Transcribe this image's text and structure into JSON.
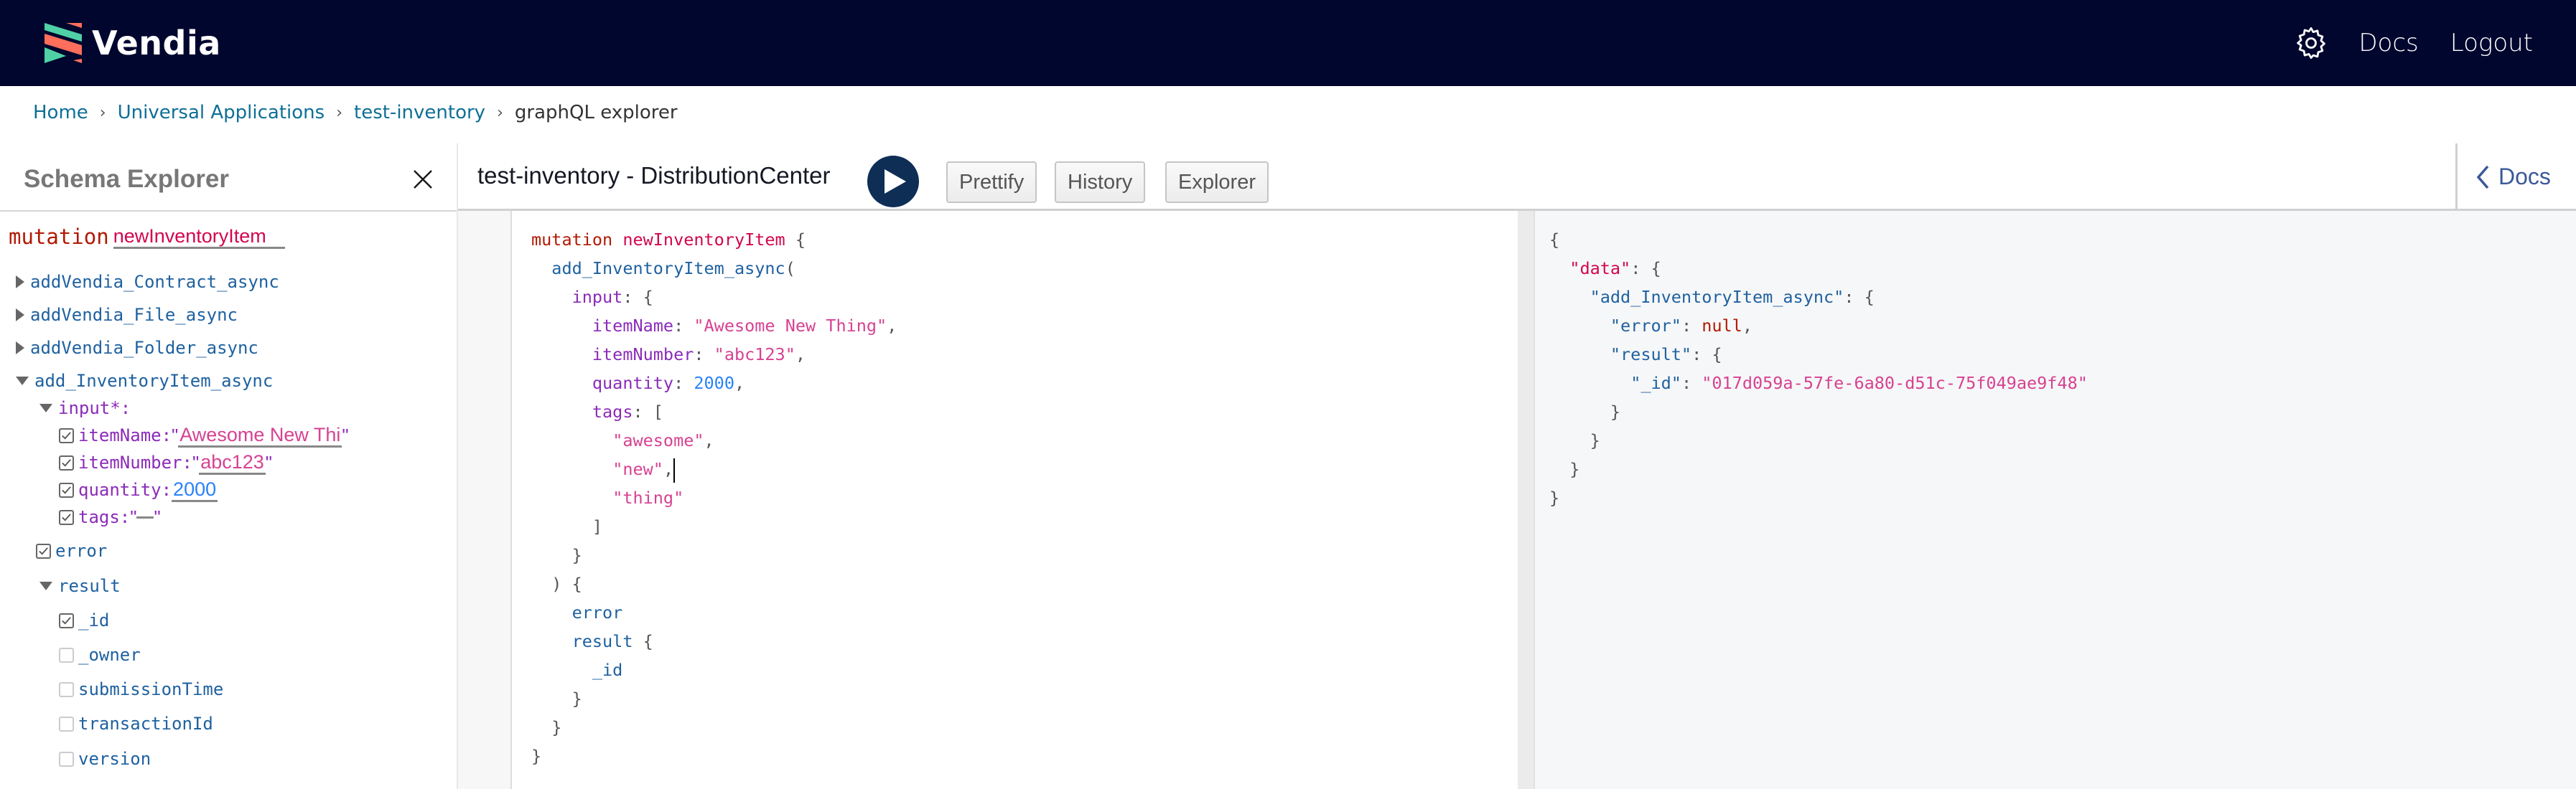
{
  "header": {
    "brand": "Vendia",
    "brand_colors": {
      "green": "#4fd1a5",
      "coral": "#ff6f5b",
      "bg": "#01062e"
    },
    "links": [
      {
        "label": "Docs"
      },
      {
        "label": "Logout"
      }
    ],
    "settings_icon": "gear-icon"
  },
  "breadcrumb": {
    "items": [
      {
        "label": "Home",
        "link": true
      },
      {
        "label": "Universal Applications",
        "link": true
      },
      {
        "label": "test-inventory",
        "link": true
      },
      {
        "label": "graphQL explorer",
        "link": false
      }
    ],
    "separator": "›"
  },
  "sidebar": {
    "title": "Schema Explorer",
    "close_icon": "close-icon",
    "operation_keyword": "mutation",
    "operation_name": "newInventoryItem",
    "tree": {
      "collapsed_fields": [
        "addVendia_Contract_async",
        "addVendia_File_async",
        "addVendia_Folder_async"
      ],
      "expanded_field": "add_InventoryItem_async",
      "input_label": "input*:",
      "inputs": [
        {
          "name": "itemName:",
          "value": "Awesome New Thi",
          "type": "string",
          "checked": true
        },
        {
          "name": "itemNumber:",
          "value": "abc123",
          "type": "string",
          "checked": true
        },
        {
          "name": "quantity:",
          "value": "2000",
          "type": "number",
          "checked": true
        },
        {
          "name": "tags:",
          "value": "",
          "type": "string",
          "checked": true
        }
      ],
      "error_field": {
        "name": "error",
        "checked": true
      },
      "result_field": "result",
      "result_subfields": [
        {
          "name": "_id",
          "checked": true
        },
        {
          "name": "_owner",
          "checked": false
        },
        {
          "name": "submissionTime",
          "checked": false
        },
        {
          "name": "transactionId",
          "checked": false
        },
        {
          "name": "version",
          "checked": false
        }
      ]
    }
  },
  "toolbar": {
    "title": "test-inventory - DistributionCenter",
    "run_icon": "play-icon",
    "buttons": [
      {
        "label": "Prettify"
      },
      {
        "label": "History"
      },
      {
        "label": "Explorer"
      }
    ],
    "docs_label": "Docs"
  },
  "editor": {
    "lines": [
      [
        [
          "c-kw",
          "mutation"
        ],
        [
          "",
          ""
        ],
        [
          "c-def",
          " newInventoryItem"
        ],
        [
          "",
          " {"
        ]
      ],
      [
        [
          "",
          "  "
        ],
        [
          "c-field",
          "add_InventoryItem_async"
        ],
        [
          "",
          "("
        ]
      ],
      [
        [
          "",
          "    "
        ],
        [
          "c-attr",
          "input"
        ],
        [
          "",
          ": {"
        ]
      ],
      [
        [
          "",
          "      "
        ],
        [
          "c-attr",
          "itemName"
        ],
        [
          "",
          ": "
        ],
        [
          "c-str",
          "\"Awesome New Thing\""
        ],
        [
          "",
          ","
        ]
      ],
      [
        [
          "",
          "      "
        ],
        [
          "c-attr",
          "itemNumber"
        ],
        [
          "",
          ": "
        ],
        [
          "c-str",
          "\"abc123\""
        ],
        [
          "",
          ","
        ]
      ],
      [
        [
          "",
          "      "
        ],
        [
          "c-attr",
          "quantity"
        ],
        [
          "",
          ": "
        ],
        [
          "c-num",
          "2000"
        ],
        [
          "",
          ","
        ]
      ],
      [
        [
          "",
          "      "
        ],
        [
          "c-attr",
          "tags"
        ],
        [
          "",
          ": ["
        ]
      ],
      [
        [
          "",
          "        "
        ],
        [
          "c-str",
          "\"awesome\""
        ],
        [
          "",
          ","
        ]
      ],
      [
        [
          "",
          "        "
        ],
        [
          "c-str",
          "\"new\""
        ],
        [
          "",
          ","
        ],
        [
          "cursor",
          ""
        ]
      ],
      [
        [
          "",
          "        "
        ],
        [
          "c-str",
          "\"thing\""
        ]
      ],
      [
        [
          "",
          "      ]"
        ]
      ],
      [
        [
          "",
          "    }"
        ]
      ],
      [
        [
          "",
          "  ) {"
        ]
      ],
      [
        [
          "",
          "    "
        ],
        [
          "c-field",
          "error"
        ]
      ],
      [
        [
          "",
          "    "
        ],
        [
          "c-field",
          "result"
        ],
        [
          "",
          " {"
        ]
      ],
      [
        [
          "",
          "      "
        ],
        [
          "c-field",
          "_id"
        ]
      ],
      [
        [
          "",
          "    }"
        ]
      ],
      [
        [
          "",
          "  }"
        ]
      ],
      [
        [
          "",
          "}"
        ]
      ]
    ]
  },
  "results": {
    "lines": [
      [
        [
          "",
          "{"
        ]
      ],
      [
        [
          "",
          "  "
        ],
        [
          "r-data",
          "\"data\""
        ],
        [
          "",
          ": {"
        ]
      ],
      [
        [
          "",
          "    "
        ],
        [
          "r-key",
          "\"add_InventoryItem_async\""
        ],
        [
          "",
          ": {"
        ]
      ],
      [
        [
          "",
          "      "
        ],
        [
          "r-key",
          "\"error\""
        ],
        [
          "",
          ": "
        ],
        [
          "c-null",
          "null"
        ],
        [
          "",
          ","
        ]
      ],
      [
        [
          "",
          "      "
        ],
        [
          "r-key",
          "\"result\""
        ],
        [
          "",
          ": {"
        ]
      ],
      [
        [
          "",
          "        "
        ],
        [
          "r-key",
          "\"_id\""
        ],
        [
          "",
          ": "
        ],
        [
          "c-str",
          "\"017d059a-57fe-6a80-d51c-75f049ae9f48\""
        ]
      ],
      [
        [
          "",
          "      }"
        ]
      ],
      [
        [
          "",
          "    }"
        ]
      ],
      [
        [
          "",
          "  }"
        ]
      ],
      [
        [
          "",
          "}"
        ]
      ]
    ]
  }
}
